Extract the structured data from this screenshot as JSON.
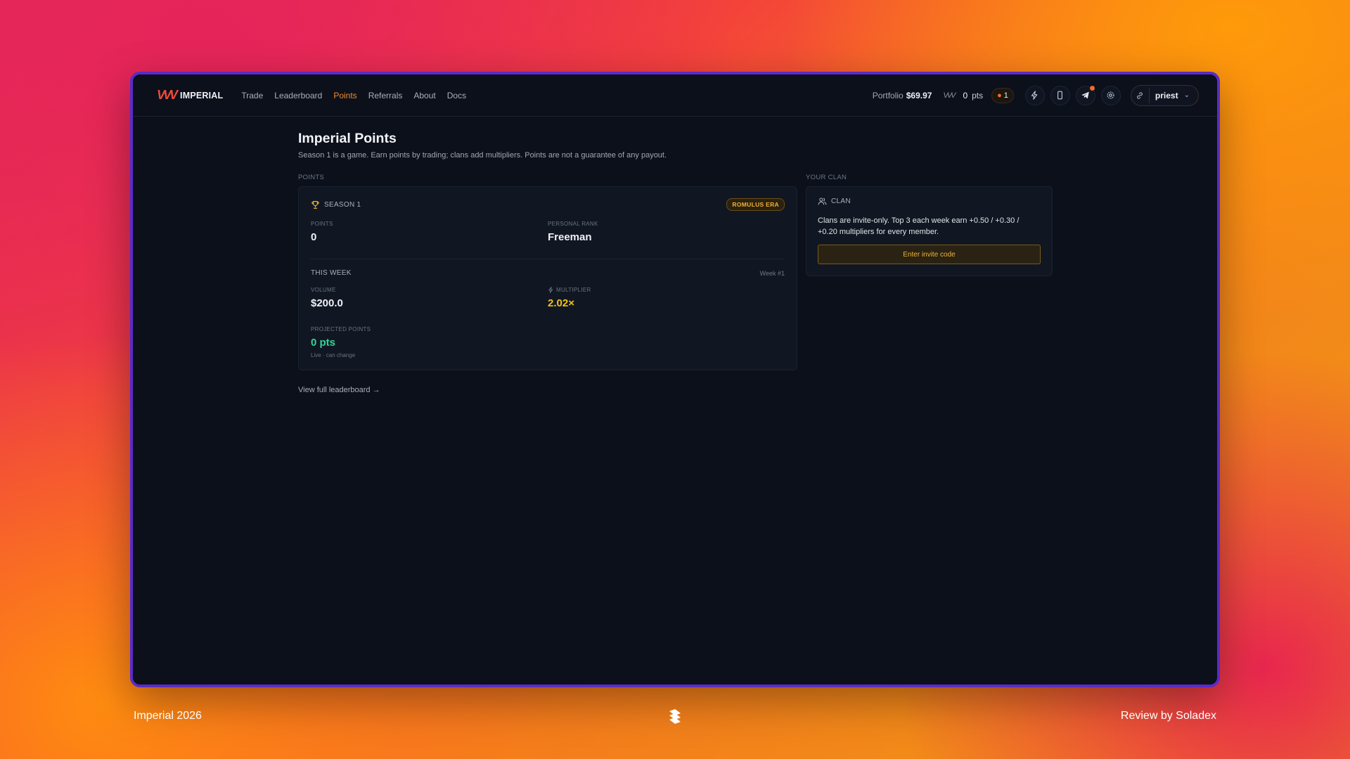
{
  "app": {
    "logo_mark": "VVV",
    "name": "IMPERIAL",
    "nav": [
      {
        "label": "Trade",
        "active": false
      },
      {
        "label": "Leaderboard",
        "active": false
      },
      {
        "label": "Points",
        "active": true
      },
      {
        "label": "Referrals",
        "active": false
      },
      {
        "label": "About",
        "active": false
      },
      {
        "label": "Docs",
        "active": false
      }
    ],
    "portfolio_label": "Portfolio",
    "portfolio_value": "$69.97",
    "pts_value": "0",
    "pts_unit": "pts",
    "streak": "1",
    "username": "priest",
    "accent": "#f08a2a"
  },
  "page": {
    "title": "Imperial Points",
    "subtitle": "Season 1 is a game. Earn points by trading; clans add multipliers. Points are not a guarantee of any payout.",
    "points_section": "POINTS",
    "clan_section": "YOUR CLAN"
  },
  "points_card": {
    "season": "SEASON 1",
    "era_badge": "ROMULUS ERA",
    "points_label": "POINTS",
    "points_value": "0",
    "rank_label": "PERSONAL RANK",
    "rank_value": "Freeman",
    "week_label": "THIS WEEK",
    "week_number": "Week #1",
    "volume_label": "VOLUME",
    "volume_value": "$200.0",
    "multiplier_label": "MULTIPLIER",
    "multiplier_value": "2.02×",
    "projected_label": "PROJECTED POINTS",
    "projected_value": "0 pts",
    "projected_note": "Live · can change"
  },
  "leaderboard_link": "View full leaderboard →",
  "clan_card": {
    "label": "CLAN",
    "text": "Clans are invite-only. Top 3 each week earn +0.50 / +0.30 / +0.20 multipliers for every member.",
    "button": "Enter invite code"
  },
  "footer": {
    "left": "Imperial 2026",
    "right": "Review by Soladex"
  }
}
